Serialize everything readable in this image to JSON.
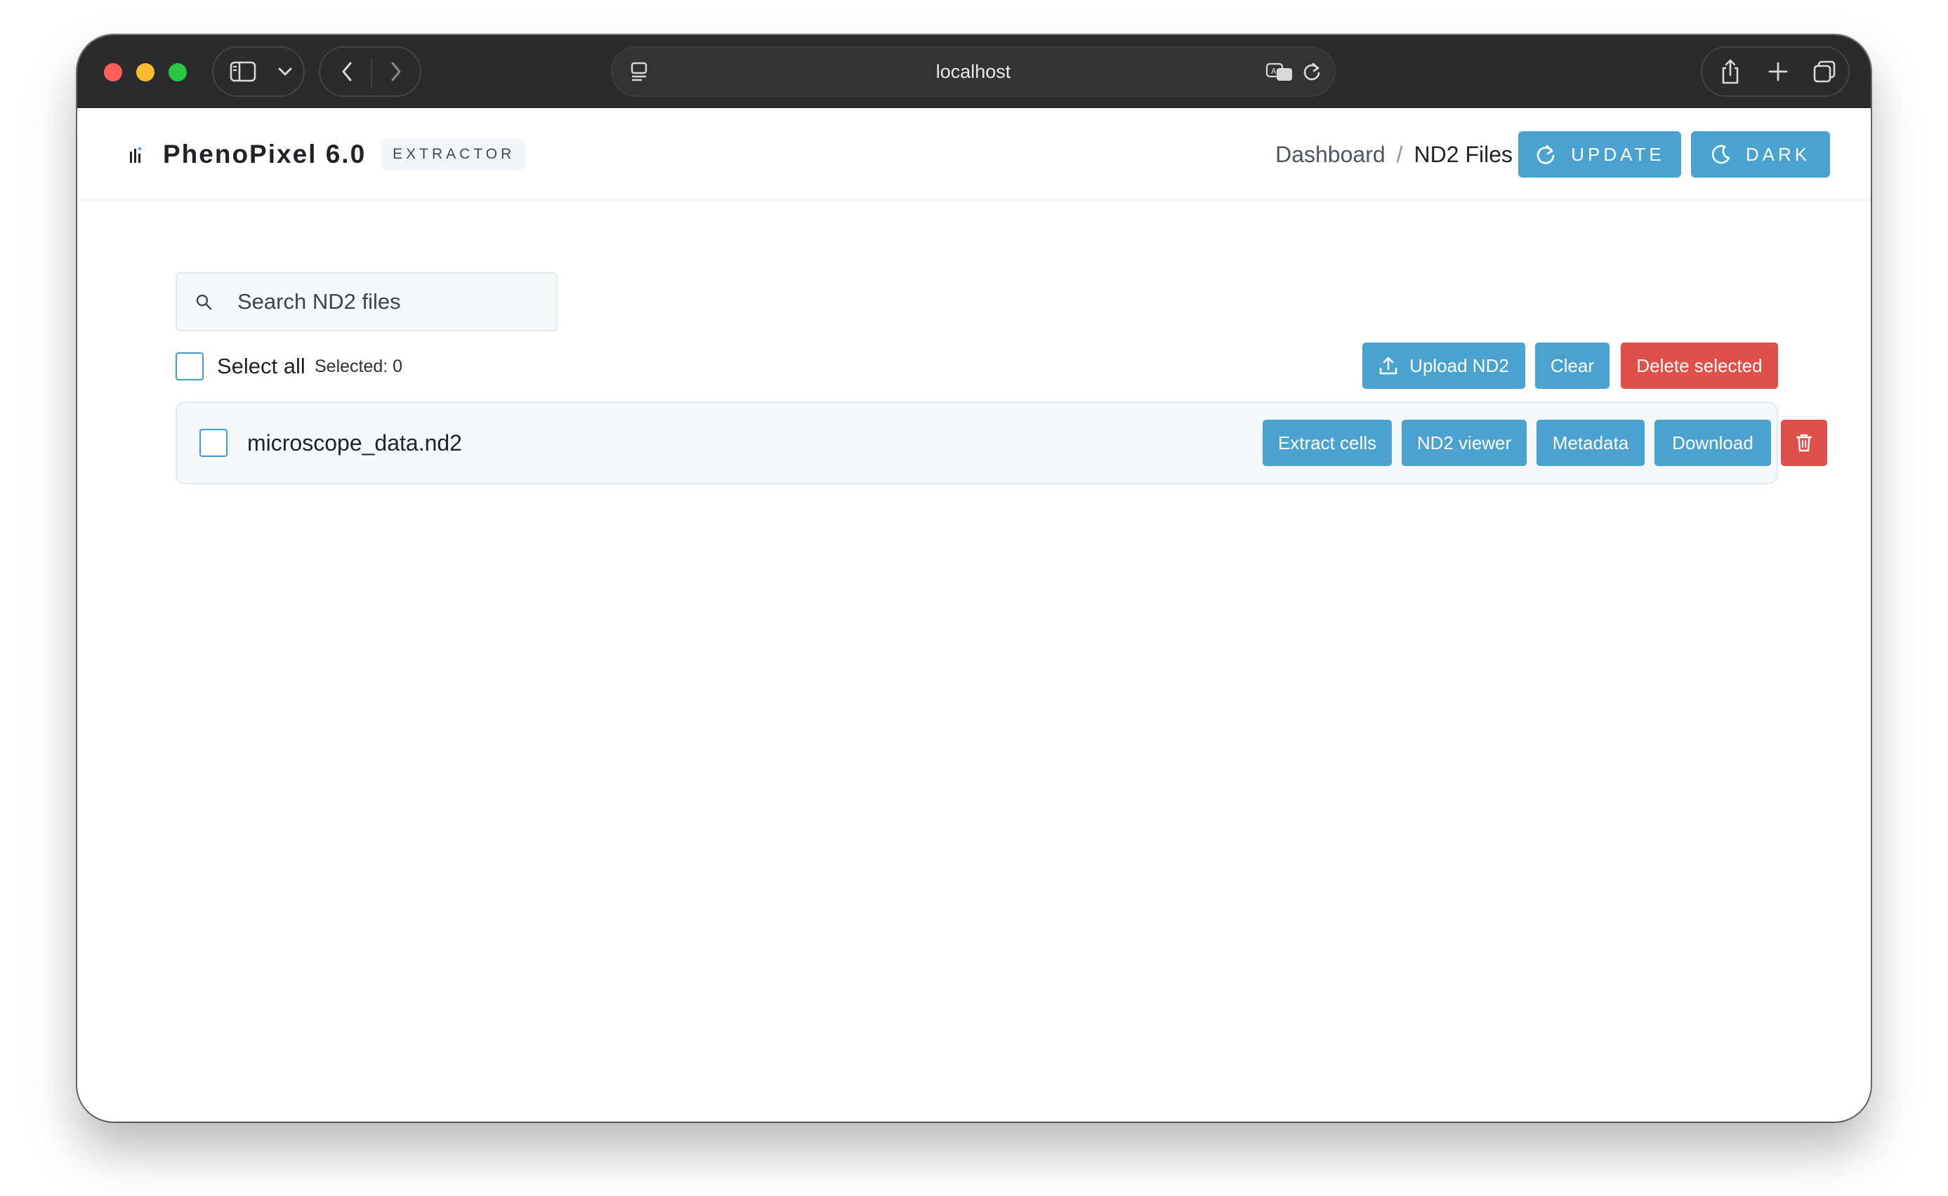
{
  "browser": {
    "url": "localhost"
  },
  "header": {
    "app_title": "PhenoPixel 6.0",
    "badge": "EXTRACTOR",
    "breadcrumb": {
      "parent": "Dashboard",
      "separator": "/",
      "current": "ND2 Files"
    },
    "update_label": "UPDATE",
    "dark_label": "DARK"
  },
  "search": {
    "placeholder": "Search ND2 files",
    "value": ""
  },
  "selection": {
    "select_all_label": "Select all",
    "selected_count": "Selected: 0"
  },
  "toolbar": {
    "upload_label": "Upload ND2",
    "clear_label": "Clear",
    "delete_selected_label": "Delete selected"
  },
  "files": [
    {
      "name": "microscope_data.nd2",
      "actions": {
        "extract": "Extract cells",
        "viewer": "ND2 viewer",
        "metadata": "Metadata",
        "download": "Download"
      }
    }
  ],
  "colors": {
    "primary": "#4aa3cf",
    "danger": "#e0504b",
    "titlebar": "#2b2b2b"
  },
  "icons": {
    "update": "refresh-icon",
    "dark": "moon-icon",
    "search": "search-icon",
    "upload": "upload-icon",
    "delete": "trash-icon"
  }
}
